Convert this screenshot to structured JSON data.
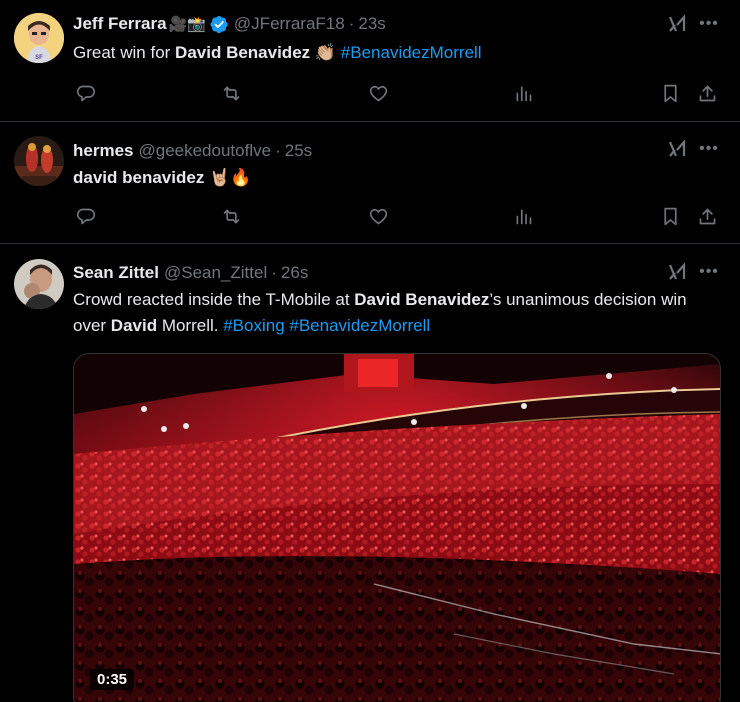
{
  "tweets": [
    {
      "name": "Jeff Ferrara",
      "name_emojis": "🎥📸",
      "handle": "@JFerraraF18",
      "time": "23s",
      "text_parts": [
        {
          "text": "Great win for ",
          "style": "plain"
        },
        {
          "text": "David Benavidez",
          "style": "bold"
        },
        {
          "text": " 👏🏼 ",
          "style": "plain"
        },
        {
          "text": "#BenavidezMorrell",
          "style": "hashtag"
        }
      ],
      "verified": true
    },
    {
      "name": "hermes",
      "handle": "@geekedoutoflve",
      "time": "25s",
      "text_parts": [
        {
          "text": "david benavidez",
          "style": "bold"
        },
        {
          "text": " 🤘🏼🔥",
          "style": "plain"
        }
      ]
    },
    {
      "name": "Sean Zittel",
      "handle": "@Sean_Zittel",
      "time": "26s",
      "text_parts": [
        {
          "text": "Crowd reacted inside the T-Mobile at ",
          "style": "plain"
        },
        {
          "text": "David Benavidez",
          "style": "bold"
        },
        {
          "text": "’s unanimous decision win over ",
          "style": "plain"
        },
        {
          "text": "David",
          "style": "bold"
        },
        {
          "text": " Morrell. ",
          "style": "plain"
        },
        {
          "text": "#Boxing",
          "style": "hashtag"
        },
        {
          "text": " ",
          "style": "plain"
        },
        {
          "text": "#BenavidezMorrell",
          "style": "hashtag"
        }
      ],
      "video_duration": "0:35"
    }
  ],
  "separator": "·",
  "icons": {
    "reply": "reply-icon",
    "repost": "repost-icon",
    "like": "like-icon",
    "views": "views-icon",
    "bookmark": "bookmark-icon",
    "share": "share-icon",
    "grok": "grok-icon",
    "more": "more-icon"
  },
  "colors": {
    "background": "#000000",
    "text": "#e7e9ea",
    "secondary": "#71767b",
    "link": "#1d9bf0",
    "border": "#2f3336"
  }
}
